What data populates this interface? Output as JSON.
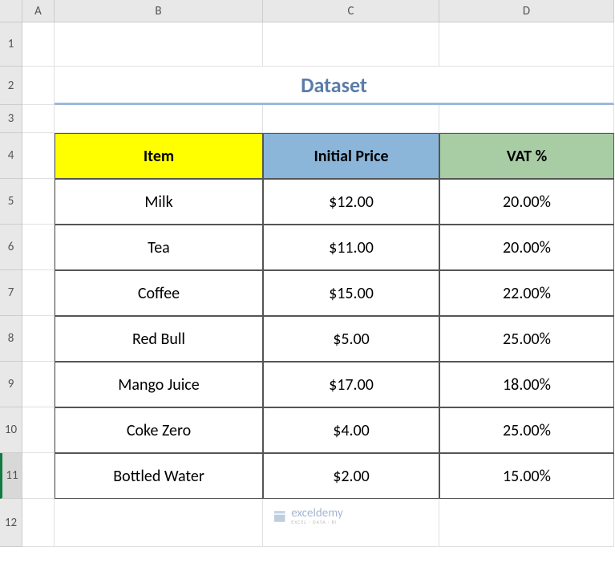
{
  "columns": {
    "a": "A",
    "b": "B",
    "c": "C",
    "d": "D"
  },
  "rows": {
    "r1": "1",
    "r2": "2",
    "r3": "3",
    "r4": "4",
    "r5": "5",
    "r6": "6",
    "r7": "7",
    "r8": "8",
    "r9": "9",
    "r10": "10",
    "r11": "11",
    "r12": "12"
  },
  "title": "Dataset",
  "headers": {
    "item": "Item",
    "price": "Initial Price",
    "vat": "VAT %"
  },
  "data": [
    {
      "item": "Milk",
      "price": "$12.00",
      "vat": "20.00%"
    },
    {
      "item": "Tea",
      "price": "$11.00",
      "vat": "20.00%"
    },
    {
      "item": "Coffee",
      "price": "$15.00",
      "vat": "22.00%"
    },
    {
      "item": "Red Bull",
      "price": "$5.00",
      "vat": "25.00%"
    },
    {
      "item": "Mango Juice",
      "price": "$17.00",
      "vat": "18.00%"
    },
    {
      "item": "Coke Zero",
      "price": "$4.00",
      "vat": "25.00%"
    },
    {
      "item": "Bottled Water",
      "price": "$2.00",
      "vat": "15.00%"
    }
  ],
  "watermark": {
    "main": "exceldemy",
    "sub": "EXCEL · DATA · BI"
  }
}
